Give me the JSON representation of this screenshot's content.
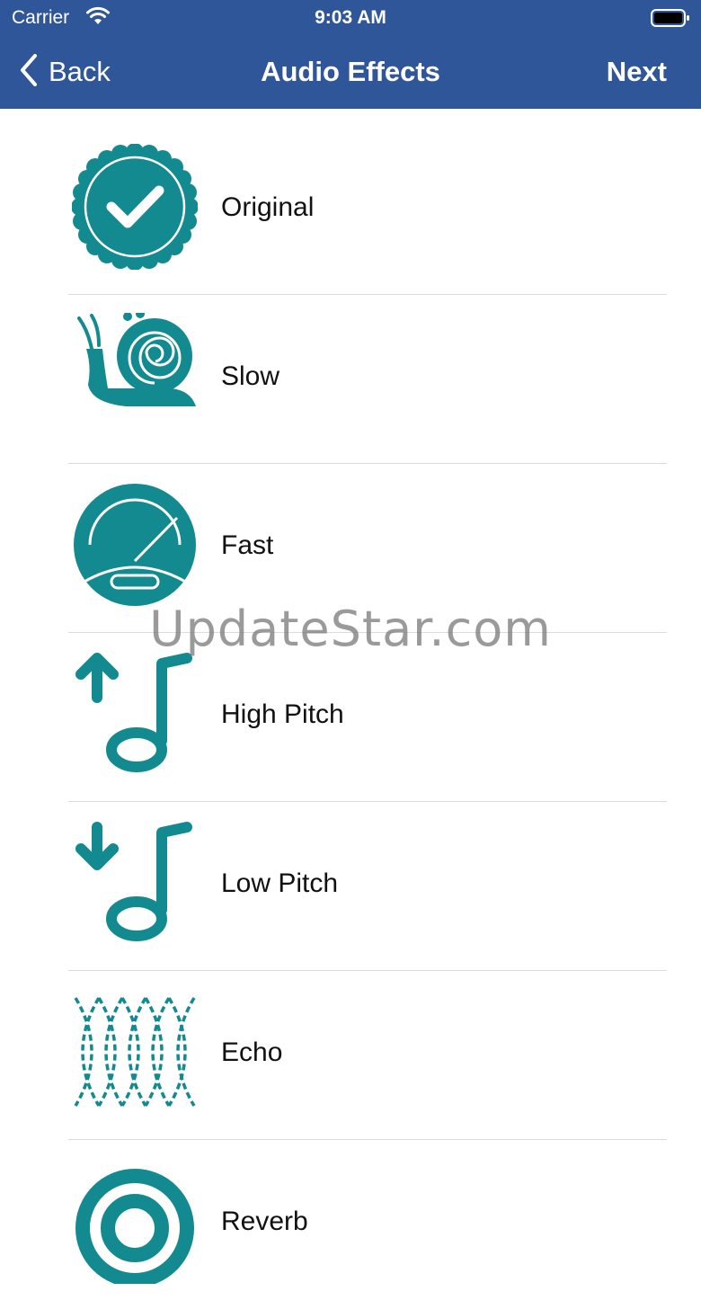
{
  "status_bar": {
    "carrier": "Carrier",
    "time": "9:03 AM"
  },
  "nav": {
    "back_label": "Back",
    "title": "Audio Effects",
    "next_label": "Next"
  },
  "effects": [
    {
      "label": "Original",
      "icon": "checkmark-badge-icon"
    },
    {
      "label": "Slow",
      "icon": "snail-icon"
    },
    {
      "label": "Fast",
      "icon": "speedometer-icon"
    },
    {
      "label": "High Pitch",
      "icon": "music-note-up-icon"
    },
    {
      "label": "Low Pitch",
      "icon": "music-note-down-icon"
    },
    {
      "label": "Echo",
      "icon": "echo-waves-icon"
    },
    {
      "label": "Reverb",
      "icon": "reverb-rings-icon"
    }
  ],
  "watermark": "UpdateStar.com",
  "colors": {
    "nav_bar": "#30569a",
    "icon_teal": "#138a90"
  }
}
